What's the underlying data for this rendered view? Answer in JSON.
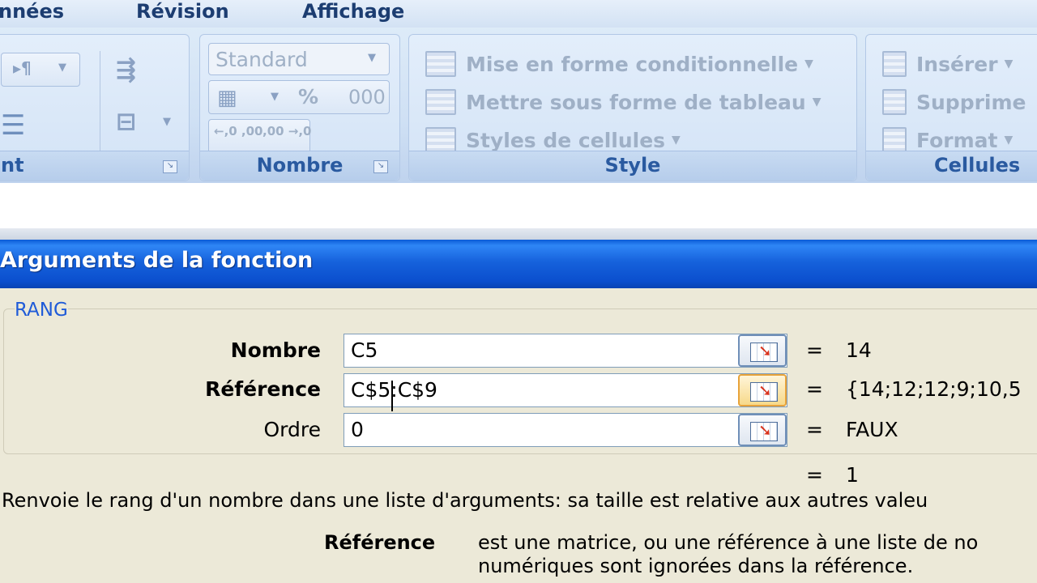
{
  "ribbon": {
    "tabs": [
      "nnées",
      "Révision",
      "Affichage"
    ],
    "alignment_group_label": "nt",
    "number_group": {
      "format_value": "Standard",
      "percent": "%",
      "thousands": "000",
      "increase_decimal": "←,0 ,00",
      "decrease_decimal": ",00 →,0",
      "label": "Nombre"
    },
    "style_group": {
      "conditional_formatting": "Mise en forme conditionnelle",
      "format_as_table": "Mettre sous forme de tableau",
      "cell_styles": "Styles de cellules",
      "label": "Style"
    },
    "cells_group": {
      "insert": "Insérer",
      "delete": "Supprime",
      "format": "Format",
      "label": "Cellules"
    }
  },
  "dialog": {
    "title": "Arguments de la fonction",
    "function_name": "RANG",
    "args": [
      {
        "label": "Nombre",
        "value": "C5",
        "result": "14"
      },
      {
        "label": "Référence",
        "value": "C$5:C$9",
        "result": "{14;12;12;9;10,5"
      },
      {
        "label": "Ordre",
        "value": "0",
        "result": "FAUX"
      }
    ],
    "equals": "=",
    "overall_result": "1",
    "description": "Renvoie le rang d'un nombre dans une liste d'arguments: sa taille est relative aux autres valeu",
    "arg_help_label": "Référence",
    "arg_help_line1": "est une matrice, ou une référence à une liste de no",
    "arg_help_line2": "numériques sont ignorées dans la référence."
  }
}
